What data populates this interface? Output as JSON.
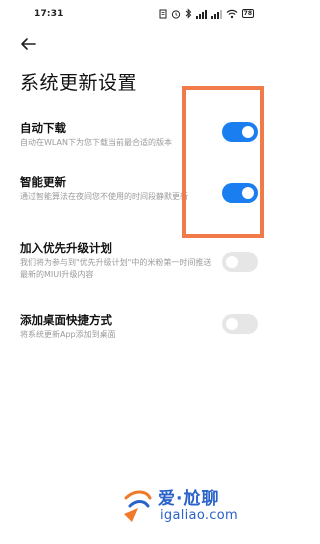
{
  "status_bar": {
    "time": "17:31",
    "battery": "78",
    "icons": [
      "notification-icon",
      "alarm-icon",
      "bluetooth-icon",
      "signal-icon",
      "signal-icon",
      "wifi-icon",
      "battery-icon"
    ]
  },
  "header": {
    "back_icon": "back-arrow-icon",
    "title": "系统更新设置"
  },
  "settings": [
    {
      "title": "自动下载",
      "desc": "自动在WLAN下为您下载当前最合适的版本",
      "enabled": true,
      "disabled": false
    },
    {
      "title": "智能更新",
      "desc": "通过智能算法在夜间您不使用的时间段静默更新",
      "enabled": true,
      "disabled": false
    },
    {
      "title": "加入优先升级计划",
      "desc": "我们将为参与到\"优先升级计划\"中的米粉第一时间推送最新的MIUI升级内容",
      "enabled": false,
      "disabled": true
    },
    {
      "title": "添加桌面快捷方式",
      "desc": "将系统更新App添加到桌面",
      "enabled": false,
      "disabled": true
    }
  ],
  "colors": {
    "toggle_on": "#1a7ef0",
    "toggle_off": "#e6e6e6",
    "highlight_box": "#f07a4a",
    "watermark": "#2a62c9"
  },
  "watermark": {
    "cn": "爱·尬聊",
    "url": "igaliao.com"
  }
}
